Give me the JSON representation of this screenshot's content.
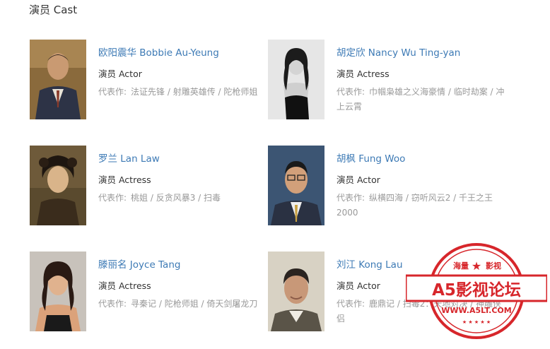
{
  "section": {
    "title": "演员 Cast"
  },
  "cast": [
    {
      "name": "欧阳震华 Bobbie Au-Yeung",
      "role": "演员 Actor",
      "works_label": "代表作:",
      "works": "法证先锋 / 射雕英雄传 / 陀枪师姐"
    },
    {
      "name": "胡定欣 Nancy Wu Ting-yan",
      "role": "演员 Actress",
      "works_label": "代表作:",
      "works": "巾帼枭雄之义海豪情 / 临时劫案 / 冲上云霄"
    },
    {
      "name": "罗兰 Lan Law",
      "role": "演员 Actress",
      "works_label": "代表作:",
      "works": "桃姐 / 反贪风暴3 / 扫毒"
    },
    {
      "name": "胡枫 Fung Woo",
      "role": "演员 Actor",
      "works_label": "代表作:",
      "works": "纵横四海 / 窃听风云2 / 千王之王2000"
    },
    {
      "name": "滕丽名 Joyce Tang",
      "role": "演员 Actress",
      "works_label": "代表作:",
      "works": "寻秦记 / 陀枪师姐 / 倚天剑屠龙刀"
    },
    {
      "name": "刘江 Kong Lau",
      "role": "演员 Actor",
      "works_label": "代表作:",
      "works": "鹿鼎记 / 扫毒2：天地对决 / 神雕侠侣"
    }
  ],
  "watermark": {
    "top_left": "海量",
    "top_right": "影视",
    "main": "A5影视论坛",
    "url": "WWW.A5LT.COM",
    "color": "#d7262b"
  }
}
